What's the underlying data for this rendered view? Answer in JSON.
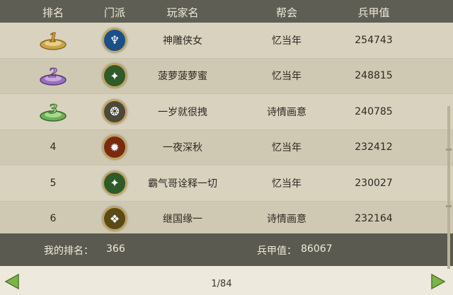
{
  "header": {
    "rank": "排名",
    "sect": "门派",
    "player": "玩家名",
    "guild": "帮会",
    "power": "兵甲值"
  },
  "rows": [
    {
      "rank": "1",
      "medal": "gold",
      "sect_icon": "blue-spirit-icon",
      "sect_color": "#1b4f8a",
      "player": "神雕侠女",
      "guild": "忆当年",
      "power": "254743"
    },
    {
      "rank": "2",
      "medal": "purple",
      "sect_icon": "green-figure-icon",
      "sect_color": "#2f5a2a",
      "player": "菠萝菠萝蜜",
      "guild": "忆当年",
      "power": "248815"
    },
    {
      "rank": "3",
      "medal": "green",
      "sect_icon": "beast-icon",
      "sect_color": "#4b4a3a",
      "player": "一岁就很拽",
      "guild": "诗情画意",
      "power": "240785"
    },
    {
      "rank": "4",
      "medal": "",
      "sect_icon": "flame-icon",
      "sect_color": "#7a2a10",
      "player": "一夜深秋",
      "guild": "忆当年",
      "power": "232412"
    },
    {
      "rank": "5",
      "medal": "",
      "sect_icon": "green-figure-icon",
      "sect_color": "#2f5a2a",
      "player": "霸气哥诠释一切",
      "guild": "忆当年",
      "power": "230027"
    },
    {
      "rank": "6",
      "medal": "",
      "sect_icon": "gold-emblem-icon",
      "sect_color": "#5a4a18",
      "player": "继国缘一",
      "guild": "诗情画意",
      "power": "232164"
    }
  ],
  "mine": {
    "rank_label": "我的排名：",
    "rank_value": "366",
    "power_label": "兵甲值：",
    "power_value": "86067"
  },
  "pager": {
    "text": "1/84"
  },
  "colors": {
    "header_bg": "#5e5e55",
    "gold": "#d9b24a",
    "purple": "#9a6fc0",
    "green": "#6fae5a"
  }
}
